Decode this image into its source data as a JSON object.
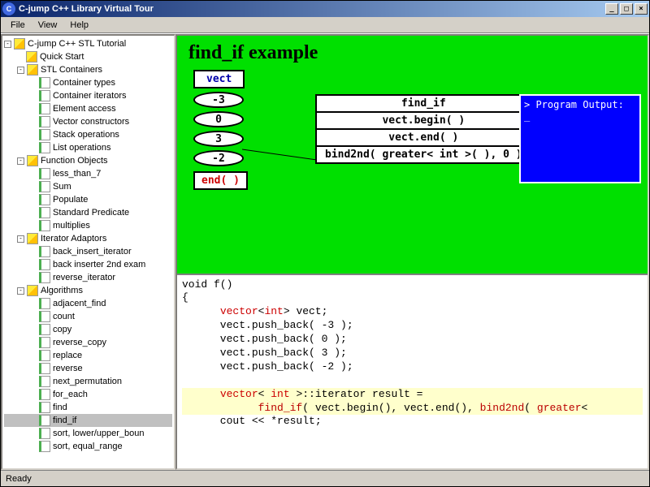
{
  "window": {
    "title": "C-jump C++ Library Virtual Tour"
  },
  "menu": {
    "file": "File",
    "view": "View",
    "help": "Help"
  },
  "tree": {
    "root": "C-jump C++ STL Tutorial",
    "items": [
      {
        "label": "Quick Start",
        "icon": "book",
        "indent": 1
      },
      {
        "label": "STL Containers",
        "icon": "book",
        "indent": 1,
        "exp": "-"
      },
      {
        "label": "Container types",
        "icon": "page",
        "indent": 2
      },
      {
        "label": "Container iterators",
        "icon": "page",
        "indent": 2
      },
      {
        "label": "Element access",
        "icon": "page",
        "indent": 2
      },
      {
        "label": "Vector constructors",
        "icon": "page",
        "indent": 2
      },
      {
        "label": "Stack operations",
        "icon": "page",
        "indent": 2
      },
      {
        "label": "List operations",
        "icon": "page",
        "indent": 2
      },
      {
        "label": "Function Objects",
        "icon": "book",
        "indent": 1,
        "exp": "-"
      },
      {
        "label": "less_than_7",
        "icon": "page",
        "indent": 2
      },
      {
        "label": "Sum",
        "icon": "page",
        "indent": 2
      },
      {
        "label": "Populate",
        "icon": "page",
        "indent": 2
      },
      {
        "label": "Standard Predicate",
        "icon": "page",
        "indent": 2
      },
      {
        "label": "multiplies",
        "icon": "page",
        "indent": 2
      },
      {
        "label": "Iterator Adaptors",
        "icon": "book",
        "indent": 1,
        "exp": "-"
      },
      {
        "label": "back_insert_iterator",
        "icon": "page",
        "indent": 2
      },
      {
        "label": "back inserter 2nd exam",
        "icon": "page",
        "indent": 2
      },
      {
        "label": "reverse_iterator",
        "icon": "page",
        "indent": 2
      },
      {
        "label": "Algorithms",
        "icon": "book",
        "indent": 1,
        "exp": "-"
      },
      {
        "label": "adjacent_find",
        "icon": "page",
        "indent": 2
      },
      {
        "label": "count",
        "icon": "page",
        "indent": 2
      },
      {
        "label": "copy",
        "icon": "page",
        "indent": 2
      },
      {
        "label": "reverse_copy",
        "icon": "page",
        "indent": 2
      },
      {
        "label": "replace",
        "icon": "page",
        "indent": 2
      },
      {
        "label": "reverse",
        "icon": "page",
        "indent": 2
      },
      {
        "label": "next_permutation",
        "icon": "page",
        "indent": 2
      },
      {
        "label": "for_each",
        "icon": "page",
        "indent": 2
      },
      {
        "label": "find",
        "icon": "page",
        "indent": 2
      },
      {
        "label": "find_if",
        "icon": "page",
        "indent": 2,
        "selected": true
      },
      {
        "label": "sort, lower/upper_boun",
        "icon": "page",
        "indent": 2
      },
      {
        "label": "sort, equal_range",
        "icon": "page",
        "indent": 2
      }
    ]
  },
  "diagram": {
    "title": "find_if example",
    "vect_label": "vect",
    "values": [
      "-3",
      "0",
      "3",
      "-2"
    ],
    "end_label": "end( )",
    "func": {
      "name": "find_if",
      "args": [
        "vect.begin( )",
        "vect.end( )",
        "bind2nd( greater< int >( ), 0 )"
      ]
    },
    "output_title": "> Program Output:",
    "output_cursor": "_"
  },
  "code": {
    "l1": "void f()",
    "l2": "{",
    "l3a": "      ",
    "l3b": "vector",
    "l3c": "<",
    "l3d": "int",
    "l3e": "> vect;",
    "l4": "      vect.push_back( -3 );",
    "l5": "      vect.push_back( 0 );",
    "l6": "      vect.push_back( 3 );",
    "l7": "      vect.push_back( -2 );",
    "blank": "",
    "h1a": "      ",
    "h1b": "vector",
    "h1c": "< ",
    "h1d": "int",
    "h1e": " >::iterator result =",
    "h2a": "            ",
    "h2b": "find_if",
    "h2c": "( vect.begin(), vect.end(), ",
    "h2d": "bind2nd",
    "h2e": "( ",
    "h2f": "greater",
    "h2g": "<",
    "l8": "      cout << *result;"
  },
  "status": {
    "text": "Ready"
  }
}
